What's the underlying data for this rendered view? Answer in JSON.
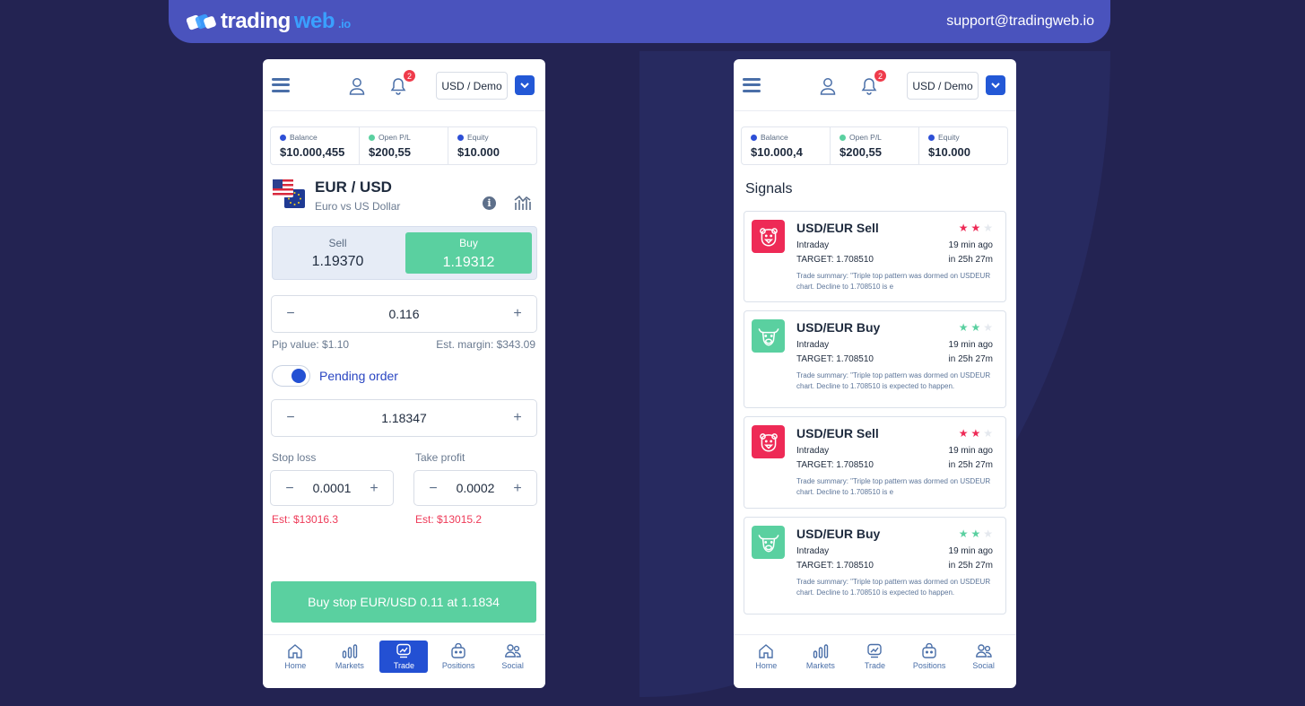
{
  "colors": {
    "brand": "#4a53bd",
    "green": "#5ad0a0",
    "red": "#ee2a56",
    "blue": "#2350d3"
  },
  "topbar": {
    "logo_trading": "trading",
    "logo_web": "web",
    "logo_io": ".io",
    "support": "support@tradingweb.io"
  },
  "header": {
    "account": "USD / Demo",
    "notif_count": "2"
  },
  "phone1": {
    "stats": [
      {
        "label": "Balance",
        "value": "$10.000,455",
        "color": "#2d4fd6"
      },
      {
        "label": "Open P/L",
        "value": "$200,55",
        "color": "#5ad0a0"
      },
      {
        "label": "Equity",
        "value": "$10.000",
        "color": "#2d4fd6"
      }
    ],
    "pair": {
      "title": "EUR / USD",
      "subtitle": "Euro vs US Dollar"
    },
    "sell": {
      "label": "Sell",
      "value": "1.19370"
    },
    "buy": {
      "label": "Buy",
      "value": "1.19312"
    },
    "amount": "0.116",
    "pip_value": "Pip value: $1.10",
    "est_margin": "Est. margin: $343.09",
    "pending_label": "Pending order",
    "pending_price": "1.18347",
    "stop_loss": {
      "label": "Stop loss",
      "value": "0.0001",
      "est": "Est: $13016.3"
    },
    "take_profit": {
      "label": "Take profit",
      "value": "0.0002",
      "est": "Est: $13015.2"
    },
    "buy_button": "Buy stop EUR/USD 0.11 at 1.1834"
  },
  "phone2": {
    "stats": [
      {
        "label": "Balance",
        "value": "$10.000,4",
        "color": "#2d4fd6"
      },
      {
        "label": "Open P/L",
        "value": "$200,55",
        "color": "#5ad0a0"
      },
      {
        "label": "Equity",
        "value": "$10.000",
        "color": "#2d4fd6"
      }
    ],
    "signals_title": "Signals",
    "signals": [
      {
        "title": "USD/EUR Sell",
        "type": "sell",
        "stars": 2,
        "timeframe": "Intraday",
        "ago": "19 min ago",
        "target": "TARGET: 1.708510",
        "expires": "in 25h 27m",
        "summary": "Trade summary: \"Triple top pattern was dormed on USDEUR chart. Decline to 1.708510 is e"
      },
      {
        "title": "USD/EUR Buy",
        "type": "buy",
        "stars": 2,
        "timeframe": "Intraday",
        "ago": "19 min ago",
        "target": "TARGET: 1.708510",
        "expires": "in 25h 27m",
        "summary": "Trade summary: \"Triple top pattern was dormed on USDEUR chart. Decline to 1.708510 is expected to happen."
      },
      {
        "title": "USD/EUR Sell",
        "type": "sell",
        "stars": 2,
        "timeframe": "Intraday",
        "ago": "19 min ago",
        "target": "TARGET: 1.708510",
        "expires": "in 25h 27m",
        "summary": "Trade summary: \"Triple top pattern was dormed on USDEUR chart. Decline to 1.708510 is e"
      },
      {
        "title": "USD/EUR Buy",
        "type": "buy",
        "stars": 2,
        "timeframe": "Intraday",
        "ago": "19 min ago",
        "target": "TARGET: 1.708510",
        "expires": "in 25h 27m",
        "summary": "Trade summary: \"Triple top pattern was dormed on USDEUR chart. Decline to 1.708510 is expected to happen."
      }
    ]
  },
  "nav": [
    {
      "label": "Home",
      "icon": "home-icon"
    },
    {
      "label": "Markets",
      "icon": "markets-icon"
    },
    {
      "label": "Trade",
      "icon": "trade-icon"
    },
    {
      "label": "Positions",
      "icon": "positions-icon"
    },
    {
      "label": "Social",
      "icon": "social-icon"
    }
  ],
  "nav_active_phone1": "Trade",
  "stepper": {
    "minus": "−",
    "plus": "+"
  }
}
